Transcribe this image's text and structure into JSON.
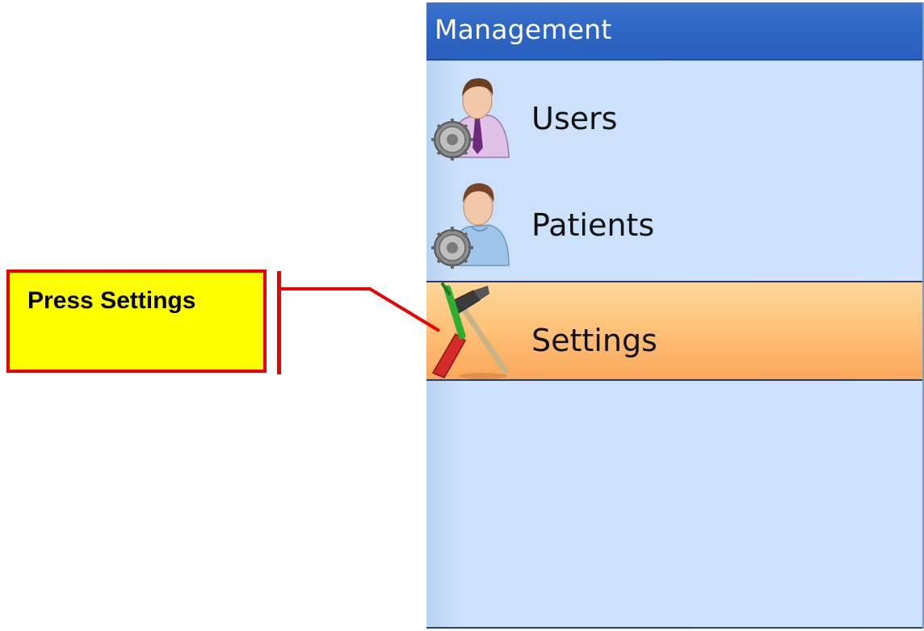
{
  "panel": {
    "title": "Management",
    "items": [
      {
        "label": "Users",
        "icon": "user-gear-icon",
        "selected": false
      },
      {
        "label": "Patients",
        "icon": "patient-gear-icon",
        "selected": false
      },
      {
        "label": "Settings",
        "icon": "tools-icon",
        "selected": true
      }
    ]
  },
  "callout": {
    "text": "Press Settings",
    "background_color": "#ffff00",
    "border_color": "#ee0000"
  },
  "colors": {
    "header": "#2f67c6",
    "panel_background": "#cde2fb",
    "selected_item": "#ffc37a"
  }
}
